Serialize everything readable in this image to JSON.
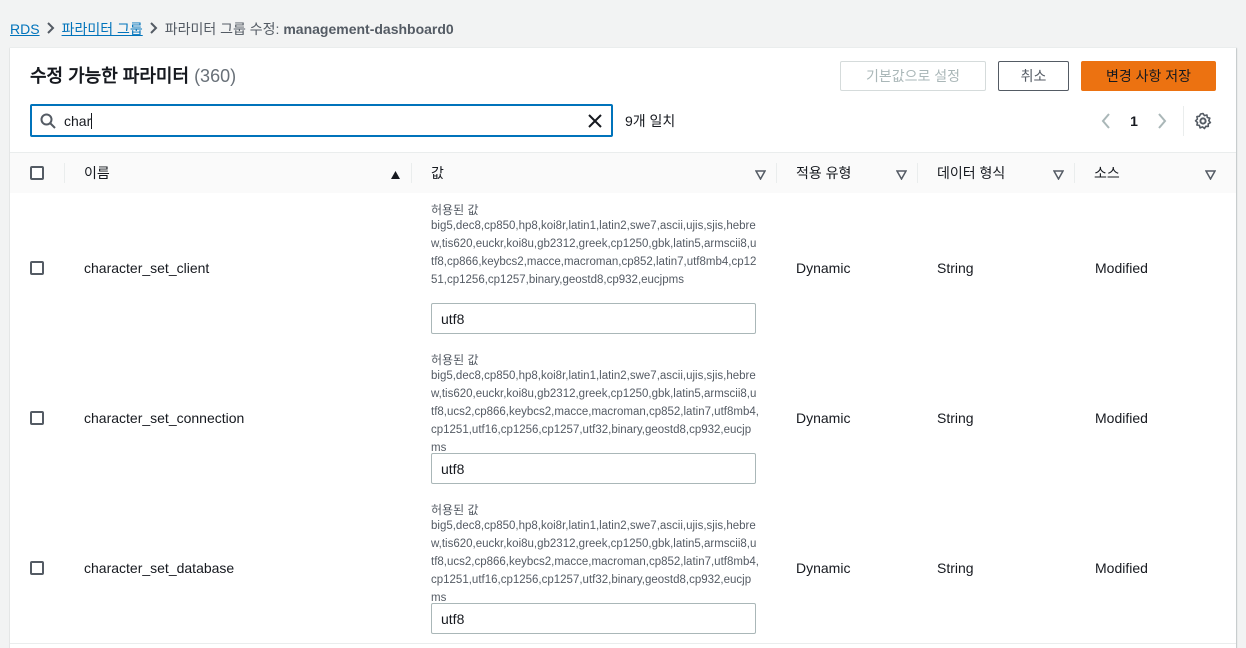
{
  "breadcrumb": {
    "items": [
      "RDS",
      "파라미터 그룹"
    ],
    "current_prefix": "파라미터 그룹 수정: ",
    "current_name": "management-dashboard0"
  },
  "panel": {
    "title": "수정 가능한 파라미터",
    "count": "(360)",
    "buttons": {
      "reset": "기본값으로 설정",
      "cancel": "취소",
      "save": "변경 사항 저장"
    }
  },
  "search": {
    "value": "char",
    "match_text": "9개 일치"
  },
  "pagination": {
    "current_page": "1"
  },
  "table": {
    "columns": [
      "이름",
      "값",
      "적용 유형",
      "데이터 형식",
      "소스"
    ],
    "allowed_label": "허용된 값",
    "rows": [
      {
        "name": "character_set_client",
        "allowed": "big5,dec8,cp850,hp8,koi8r,latin1,latin2,swe7,ascii,ujis,sjis,hebrew,tis620,euckr,koi8u,gb2312,greek,cp1250,gbk,latin5,armscii8,utf8,cp866,keybcs2,macce,macroman,cp852,latin7,utf8mb4,cp1251,cp1256,cp1257,binary,geostd8,cp932,eucjpms",
        "value": "utf8",
        "apply_type": "Dynamic",
        "data_type": "String",
        "source": "Modified"
      },
      {
        "name": "character_set_connection",
        "allowed": "big5,dec8,cp850,hp8,koi8r,latin1,latin2,swe7,ascii,ujis,sjis,hebrew,tis620,euckr,koi8u,gb2312,greek,cp1250,gbk,latin5,armscii8,utf8,ucs2,cp866,keybcs2,macce,macroman,cp852,latin7,utf8mb4,cp1251,utf16,cp1256,cp1257,utf32,binary,geostd8,cp932,eucjpms",
        "value": "utf8",
        "apply_type": "Dynamic",
        "data_type": "String",
        "source": "Modified"
      },
      {
        "name": "character_set_database",
        "allowed": "big5,dec8,cp850,hp8,koi8r,latin1,latin2,swe7,ascii,ujis,sjis,hebrew,tis620,euckr,koi8u,gb2312,greek,cp1250,gbk,latin5,armscii8,utf8,ucs2,cp866,keybcs2,macce,macroman,cp852,latin7,utf8mb4,cp1251,utf16,cp1256,cp1257,utf32,binary,geostd8,cp932,eucjpms",
        "value": "utf8",
        "apply_type": "Dynamic",
        "data_type": "String",
        "source": "Modified"
      }
    ]
  }
}
